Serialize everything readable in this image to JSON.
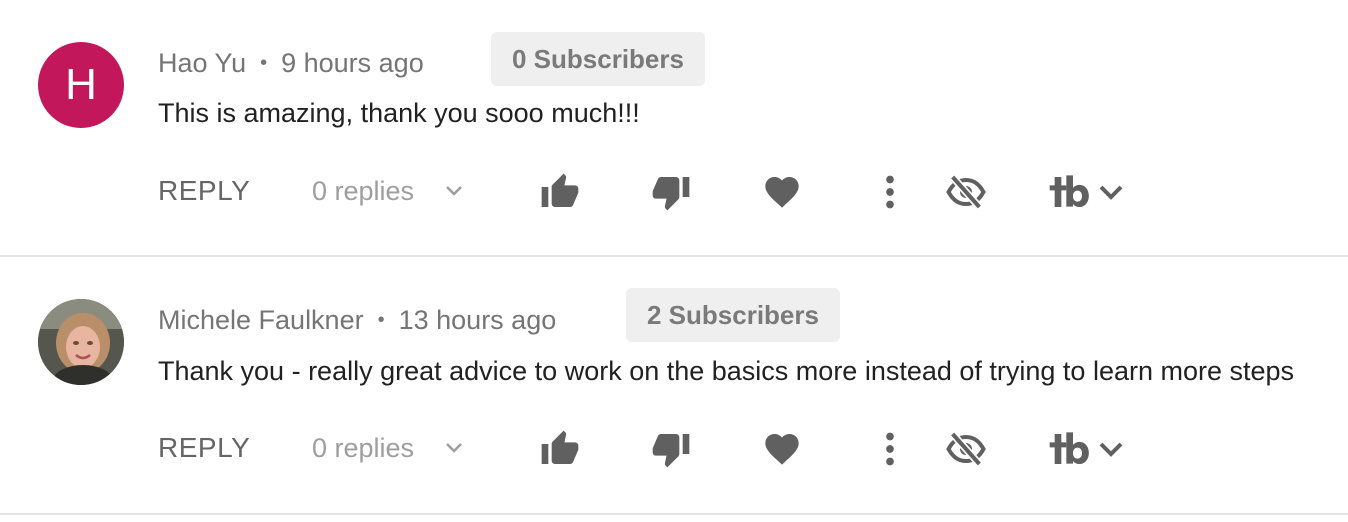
{
  "colors": {
    "avatar_bg": "#c2185b",
    "icon_gray": "#606060",
    "badge_bg": "#efefef",
    "divider": "#e4e4e4"
  },
  "comments": [
    {
      "avatar_letter": "H",
      "author": "Hao Yu",
      "separator": "•",
      "time": "9 hours ago",
      "subscribers": "0 Subscribers",
      "text": "This is amazing, thank you sooo much!!!",
      "reply_label": "REPLY",
      "replies_label": "0 replies"
    },
    {
      "avatar_letter": "",
      "author": "Michele Faulkner",
      "separator": "•",
      "time": "13 hours ago",
      "subscribers": "2 Subscribers",
      "text": "Thank you - really great advice to work on the basics more instead of trying to learn more steps",
      "reply_label": "REPLY",
      "replies_label": "0 replies"
    }
  ],
  "icons": [
    "chevron-down-icon",
    "thumbs-up-icon",
    "thumbs-down-icon",
    "heart-icon",
    "more-vertical-icon",
    "eye-off-icon",
    "tubebuddy-logo-icon",
    "chevron-down-icon"
  ]
}
